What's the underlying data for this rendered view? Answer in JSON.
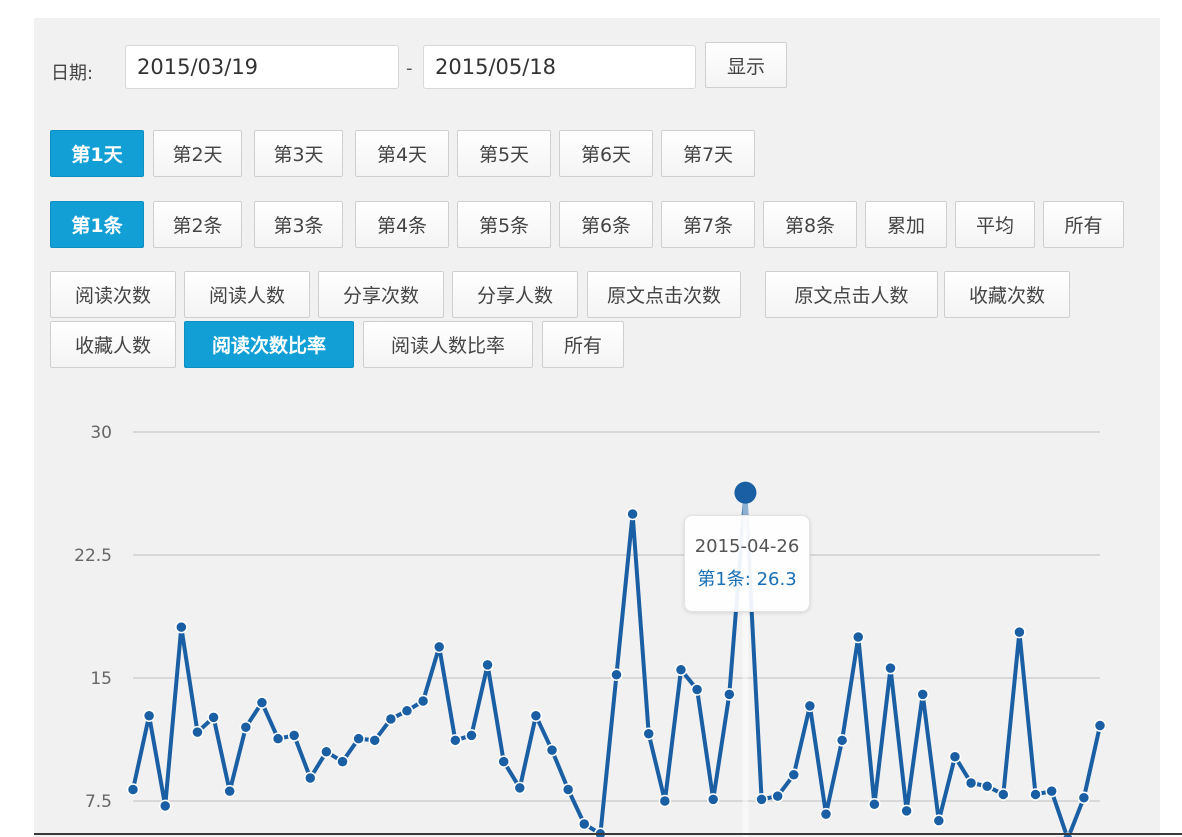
{
  "filters": {
    "date_label": "日期:",
    "start_date": "2015/03/19",
    "separator": "-",
    "end_date": "2015/05/18",
    "show_label": "显示"
  },
  "day_tabs": [
    "第1天",
    "第2天",
    "第3天",
    "第4天",
    "第5天",
    "第6天",
    "第7天"
  ],
  "article_tabs": [
    "第1条",
    "第2条",
    "第3条",
    "第4条",
    "第5条",
    "第6条",
    "第7条",
    "第8条",
    "累加",
    "平均",
    "所有"
  ],
  "metric_tabs": [
    "阅读次数",
    "阅读人数",
    "分享次数",
    "分享人数",
    "原文点击次数",
    "原文点击人数",
    "收藏次数",
    "收藏人数",
    "阅读次数比率",
    "阅读人数比率",
    "所有"
  ],
  "selected": {
    "day": "第1天",
    "article": "第1条",
    "metric": "阅读次数比率"
  },
  "colors": {
    "accent": "#129fd5",
    "line": "#1a5fa3"
  },
  "tooltip": {
    "date": "2015-04-26",
    "value_text": "第1条: 26.3"
  },
  "chart_data": {
    "type": "line",
    "y_ticks": [
      "30",
      "22.5",
      "15",
      "7.5"
    ],
    "ylim": [
      7.5,
      30
    ],
    "grid": true,
    "series": [
      {
        "name": "第1条",
        "values": [
          8.2,
          12.7,
          7.2,
          18.1,
          11.7,
          12.6,
          8.1,
          12,
          13.5,
          11.3,
          11.5,
          8.9,
          10.5,
          9.9,
          11.3,
          11.2,
          12.5,
          13,
          13.6,
          16.9,
          11.2,
          11.5,
          15.8,
          9.9,
          8.3,
          12.7,
          10.6,
          8.2,
          6.1,
          5.5,
          15.2,
          25,
          11.6,
          7.5,
          15.5,
          14.3,
          7.6,
          14,
          26.3,
          7.6,
          7.8,
          9.1,
          13.3,
          6.7,
          11.2,
          17.5,
          7.3,
          15.6,
          6.9,
          14,
          6.3,
          10.2,
          8.6,
          8.4,
          7.9,
          17.8,
          7.9,
          8.1,
          5.2,
          7.7,
          12.1
        ],
        "highlight_index": 38
      }
    ]
  }
}
